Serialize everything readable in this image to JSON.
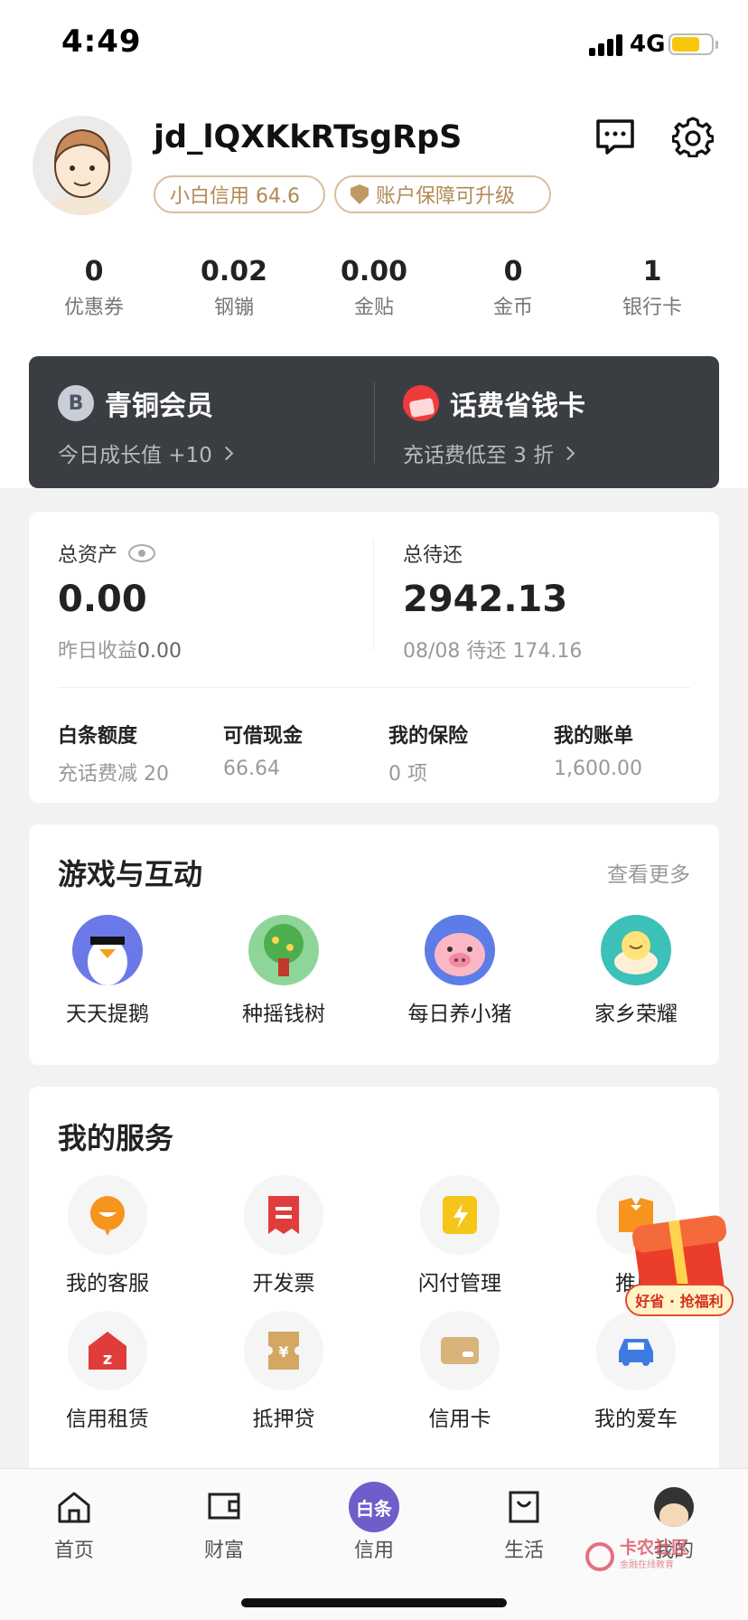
{
  "status_bar": {
    "time": "4:49",
    "network": "4G"
  },
  "profile": {
    "username": "jd_lQXKkRTsgRpS",
    "credit_chip": "小白信用 64.6",
    "protection_chip": "账户保障可升级"
  },
  "stats": [
    {
      "value": "0",
      "label": "优惠券"
    },
    {
      "value": "0.02",
      "label": "钢镚"
    },
    {
      "value": "0.00",
      "label": "金贴"
    },
    {
      "value": "0",
      "label": "金币"
    },
    {
      "value": "1",
      "label": "银行卡"
    }
  ],
  "member": {
    "badge_letter": "B",
    "left_title": "青铜会员",
    "left_sub": "今日成长值 +10",
    "right_title": "话费省钱卡",
    "right_sub": "充话费低至 3 折"
  },
  "assets": {
    "total_label": "总资产",
    "total_value": "0.00",
    "yesterday_prefix": "昨日收益",
    "yesterday_value": "0.00",
    "due_label": "总待还",
    "due_value": "2942.13",
    "due_sub": "08/08 待还 174.16",
    "minis": [
      {
        "title": "白条额度",
        "sub": "充话费减 20"
      },
      {
        "title": "可借现金",
        "sub": "66.64"
      },
      {
        "title": "我的保险",
        "sub": "0 项"
      },
      {
        "title": "我的账单",
        "sub": "1,600.00"
      }
    ]
  },
  "games": {
    "title": "游戏与互动",
    "more": "查看更多",
    "items": [
      {
        "label": "天天提鹅"
      },
      {
        "label": "种摇钱树"
      },
      {
        "label": "每日养小猪"
      },
      {
        "label": "家乡荣耀"
      }
    ]
  },
  "services": {
    "title": "我的服务",
    "items": [
      {
        "label": "我的客服"
      },
      {
        "label": "开发票"
      },
      {
        "label": "闪付管理"
      },
      {
        "label": "推广"
      },
      {
        "label": "信用租赁"
      },
      {
        "label": "抵押贷"
      },
      {
        "label": "信用卡"
      },
      {
        "label": "我的爱车"
      }
    ]
  },
  "promo": {
    "label": "好省 · 抢福利"
  },
  "tabs": [
    {
      "label": "首页"
    },
    {
      "label": "财富"
    },
    {
      "label": "信用",
      "badge": "白条"
    },
    {
      "label": "生活"
    },
    {
      "label": "我的"
    }
  ],
  "watermark": {
    "title": "卡农社区",
    "sub": "金融在线教育"
  },
  "colors": {
    "accent_gold": "#b18a56",
    "dark_card": "#3a3d42",
    "baitiao_purple": "#6d5ec9",
    "battery": "#f7c70c"
  }
}
